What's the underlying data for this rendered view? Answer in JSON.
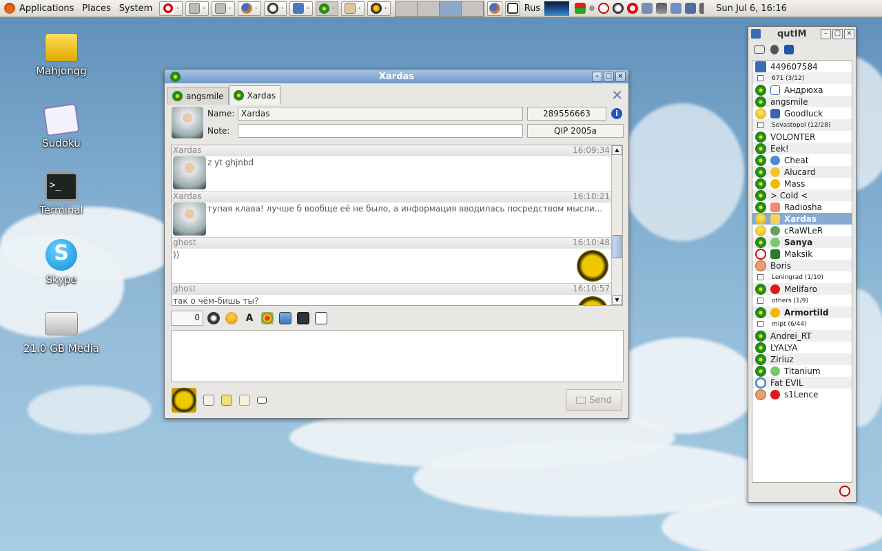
{
  "panel": {
    "applications": "Applications",
    "places": "Places",
    "system": "System",
    "lang": "Rus",
    "clock": "Sun Jul  6, 16:16"
  },
  "desktop": {
    "icons": [
      {
        "label": "Mahjongg"
      },
      {
        "label": "Sudoku"
      },
      {
        "label": "Terminal"
      },
      {
        "label": "Skype"
      },
      {
        "label": "21.0 GB Media"
      }
    ]
  },
  "chat": {
    "title": "Xardas",
    "tabs": [
      {
        "label": "angsmile"
      },
      {
        "label": "Xardas"
      }
    ],
    "name_label": "Name:",
    "name_value": "Xardas",
    "uin": "289556663",
    "note_label": "Note:",
    "note_value": "",
    "client": "QIP 2005a",
    "messages": [
      {
        "sender": "Xardas",
        "time": "16:09:34",
        "text": "z yt ghjnbd"
      },
      {
        "sender": "Xardas",
        "time": "16:10:21",
        "text": "тупая клава! лучше б вообще её не было, а информация вводилась посредством мысли..."
      },
      {
        "sender": "ghost",
        "time": "16:10:48",
        "text": "))"
      },
      {
        "sender": "ghost",
        "time": "16:10:57",
        "text": "так о чём-бишь ты?"
      }
    ],
    "counter": "0",
    "send_label": "Send"
  },
  "qutim": {
    "title": "qutIM",
    "uin": "449607584",
    "rows": [
      {
        "kind": "group",
        "text": "671 (3/12)"
      },
      {
        "kind": "contact",
        "text": "Андрюха",
        "status": "online",
        "xicon": "g-icon"
      },
      {
        "kind": "contact",
        "text": "angsmile",
        "status": "online"
      },
      {
        "kind": "contact",
        "text": "Goodluck",
        "status": "smile",
        "xicon": "joystick-icon"
      },
      {
        "kind": "group",
        "text": "Sevastopol (12/28)"
      },
      {
        "kind": "contact",
        "text": "VOLONTER",
        "status": "online"
      },
      {
        "kind": "contact",
        "text": "Eek!",
        "status": "online"
      },
      {
        "kind": "contact",
        "text": "Cheat",
        "status": "online",
        "xicon": "globe-icon"
      },
      {
        "kind": "contact",
        "text": "Alucard",
        "status": "online",
        "xicon": "smile-icon"
      },
      {
        "kind": "contact",
        "text": "Mass",
        "status": "online",
        "xicon": "grin-icon"
      },
      {
        "kind": "contact",
        "text": "> Cold <",
        "status": "online"
      },
      {
        "kind": "contact",
        "text": "Radiosha",
        "status": "online",
        "xicon": "girl-icon"
      },
      {
        "kind": "contact",
        "text": "Xardas",
        "status": "smile",
        "selected": true,
        "xicon": "duck-icon"
      },
      {
        "kind": "contact",
        "text": "cRaWLeR",
        "status": "smile",
        "xicon": "gear-icon"
      },
      {
        "kind": "contact",
        "text": "Sanya",
        "status": "online",
        "bold": true,
        "xicon": "question-icon"
      },
      {
        "kind": "contact",
        "text": "Maksik",
        "status": "nb",
        "xicon": "tv-icon"
      },
      {
        "kind": "contact",
        "text": "Boris",
        "status": "hand"
      },
      {
        "kind": "group",
        "text": "Leningrad (1/10)"
      },
      {
        "kind": "contact",
        "text": "Melifaro",
        "status": "online",
        "xicon": "heart-icon"
      },
      {
        "kind": "group",
        "text": "others (1/9)"
      },
      {
        "kind": "contact",
        "text": "Armortild",
        "status": "online",
        "bold": true,
        "xicon": "grin-icon"
      },
      {
        "kind": "group",
        "text": "mipt (6/44)"
      },
      {
        "kind": "contact",
        "text": "Andrei_RT",
        "status": "online"
      },
      {
        "kind": "contact",
        "text": "LYALYA",
        "status": "online"
      },
      {
        "kind": "contact",
        "text": "Ziriuz",
        "status": "online"
      },
      {
        "kind": "contact",
        "text": "Titanium",
        "status": "online",
        "xicon": "question-icon"
      },
      {
        "kind": "contact",
        "text": "Fat EVIL",
        "status": "clock"
      },
      {
        "kind": "contact",
        "text": "s1Lence",
        "status": "hand",
        "xicon": "heart-icon"
      }
    ]
  }
}
